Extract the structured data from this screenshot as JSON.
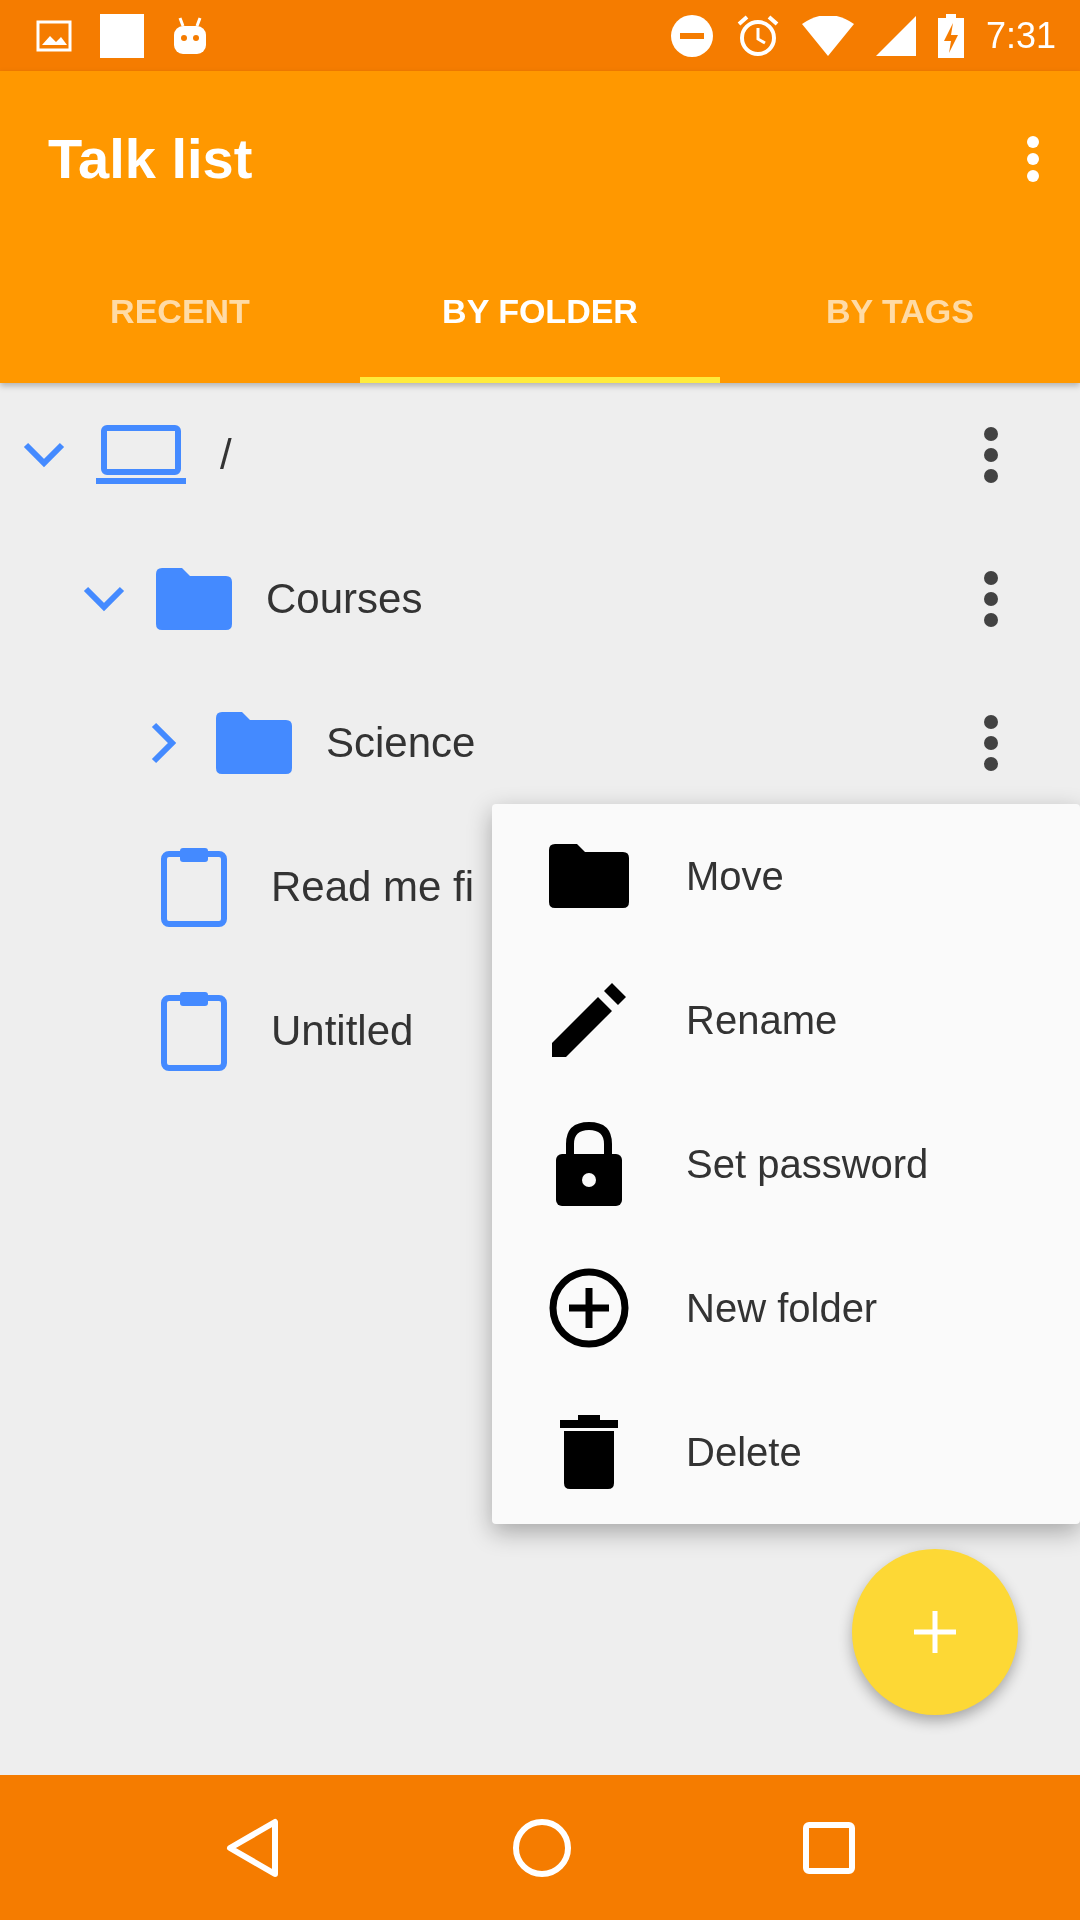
{
  "status_bar": {
    "time": "7:31"
  },
  "app_bar": {
    "title": "Talk list"
  },
  "tabs": [
    {
      "label": "RECENT",
      "selected": false
    },
    {
      "label": "BY FOLDER",
      "selected": true
    },
    {
      "label": "BY TAGS",
      "selected": false
    }
  ],
  "tree": [
    {
      "kind": "device",
      "label": "/",
      "expanded": true,
      "children": [
        {
          "kind": "folder",
          "label": "Courses",
          "expanded": true,
          "children": [
            {
              "kind": "folder",
              "label": "Science",
              "expanded": false
            },
            {
              "kind": "file",
              "label": "Read me fi"
            },
            {
              "kind": "file",
              "label": "Untitled"
            }
          ]
        }
      ]
    }
  ],
  "context_menu": [
    {
      "kind": "move",
      "label": "Move"
    },
    {
      "kind": "rename",
      "label": "Rename"
    },
    {
      "kind": "lock",
      "label": "Set password"
    },
    {
      "kind": "add",
      "label": "New folder"
    },
    {
      "kind": "delete",
      "label": "Delete"
    }
  ]
}
